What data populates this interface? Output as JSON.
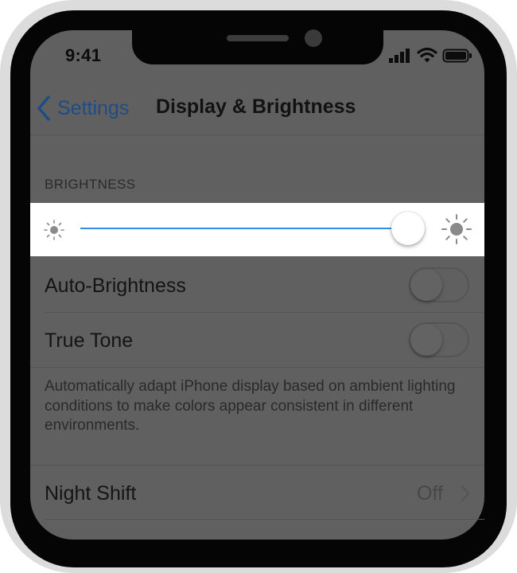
{
  "status_bar": {
    "time": "9:41",
    "icons": [
      "signal-icon",
      "wifi-icon",
      "battery-icon"
    ]
  },
  "nav": {
    "back_label": "Settings",
    "title": "Display & Brightness"
  },
  "brightness_section": {
    "header": "BRIGHTNESS",
    "slider_level_fraction": 0.97
  },
  "rows": {
    "auto_brightness": {
      "label": "Auto-Brightness",
      "enabled": false
    },
    "true_tone": {
      "label": "True Tone",
      "enabled": false
    },
    "true_tone_footnote": "Automatically adapt iPhone display based on ambient lighting conditions to make colors appear consistent in different environments.",
    "night_shift": {
      "label": "Night Shift",
      "value": "Off"
    }
  },
  "colors": {
    "accent": "#2f8de8",
    "screen_dimmed": "#606060",
    "back_link": "#1d4c86"
  }
}
